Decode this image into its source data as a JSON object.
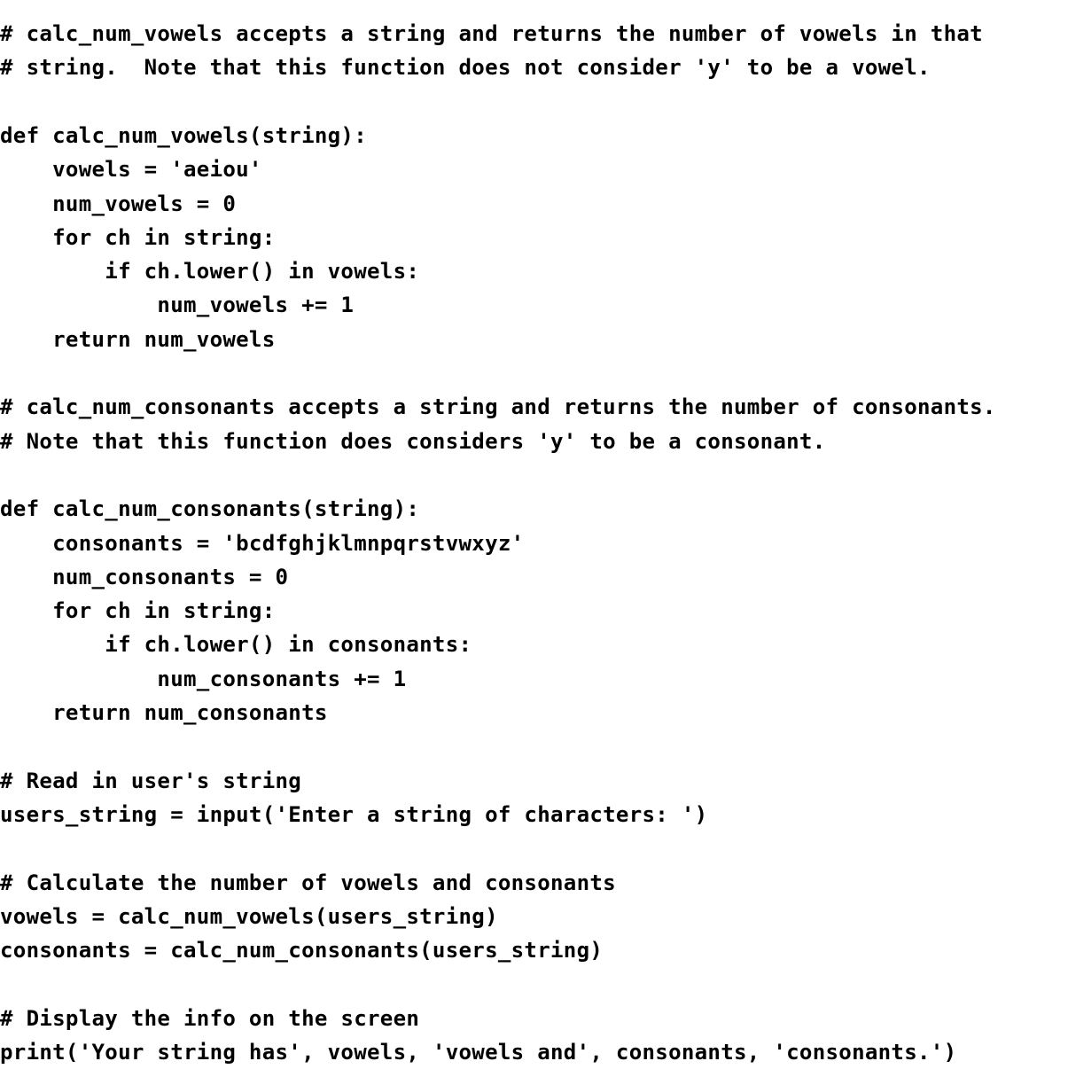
{
  "document": {
    "kind": "source-code-listing",
    "language": "Python",
    "background_color": "#ffffff",
    "text_color": "#000000",
    "indent_unit": "    "
  },
  "code": {
    "lines": [
      "# calc_num_vowels accepts a string and returns the number of vowels in that",
      "# string.  Note that this function does not consider 'y' to be a vowel.",
      "",
      "def calc_num_vowels(string):",
      "    vowels = 'aeiou'",
      "    num_vowels = 0",
      "    for ch in string:",
      "        if ch.lower() in vowels:",
      "            num_vowels += 1",
      "    return num_vowels",
      "",
      "# calc_num_consonants accepts a string and returns the number of consonants.",
      "# Note that this function does considers 'y' to be a consonant.",
      "",
      "def calc_num_consonants(string):",
      "    consonants = 'bcdfghjklmnpqrstvwxyz'",
      "    num_consonants = 0",
      "    for ch in string:",
      "        if ch.lower() in consonants:",
      "            num_consonants += 1",
      "    return num_consonants",
      "",
      "# Read in user's string",
      "users_string = input('Enter a string of characters: ')",
      "",
      "# Calculate the number of vowels and consonants",
      "vowels = calc_num_vowels(users_string)",
      "consonants = calc_num_consonants(users_string)",
      "",
      "# Display the info on the screen",
      "print('Your string has', vowels, 'vowels and', consonants, 'consonants.')"
    ]
  }
}
